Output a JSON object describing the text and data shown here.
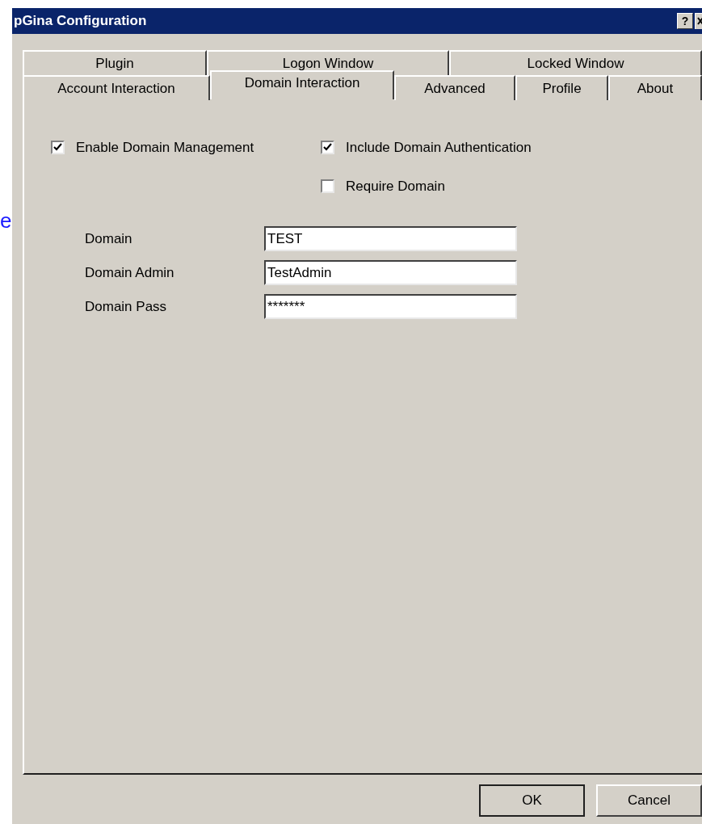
{
  "background_text": "e",
  "window": {
    "title": "pGina Configuration",
    "help_button": "?"
  },
  "tab_rows": [
    [
      {
        "label": "Plugin",
        "selected": false
      },
      {
        "label": "Logon Window",
        "selected": false
      },
      {
        "label": "Locked Window",
        "selected": false
      }
    ],
    [
      {
        "label": "Account Interaction",
        "selected": false
      },
      {
        "label": "Domain Interaction",
        "selected": true
      },
      {
        "label": "Advanced",
        "selected": false
      },
      {
        "label": "Profile",
        "selected": false
      },
      {
        "label": "About",
        "selected": false
      }
    ]
  ],
  "checkboxes": [
    {
      "label": "Enable Domain Management",
      "checked": true
    },
    {
      "label": "Include Domain Authentication",
      "checked": true
    },
    {
      "label": "Require Domain",
      "checked": false
    }
  ],
  "fields": [
    {
      "label": "Domain",
      "value": "TEST"
    },
    {
      "label": "Domain Admin",
      "value": "TestAdmin"
    },
    {
      "label": "Domain Pass",
      "value": "*******"
    }
  ],
  "buttons": [
    "OK",
    "Cancel"
  ]
}
